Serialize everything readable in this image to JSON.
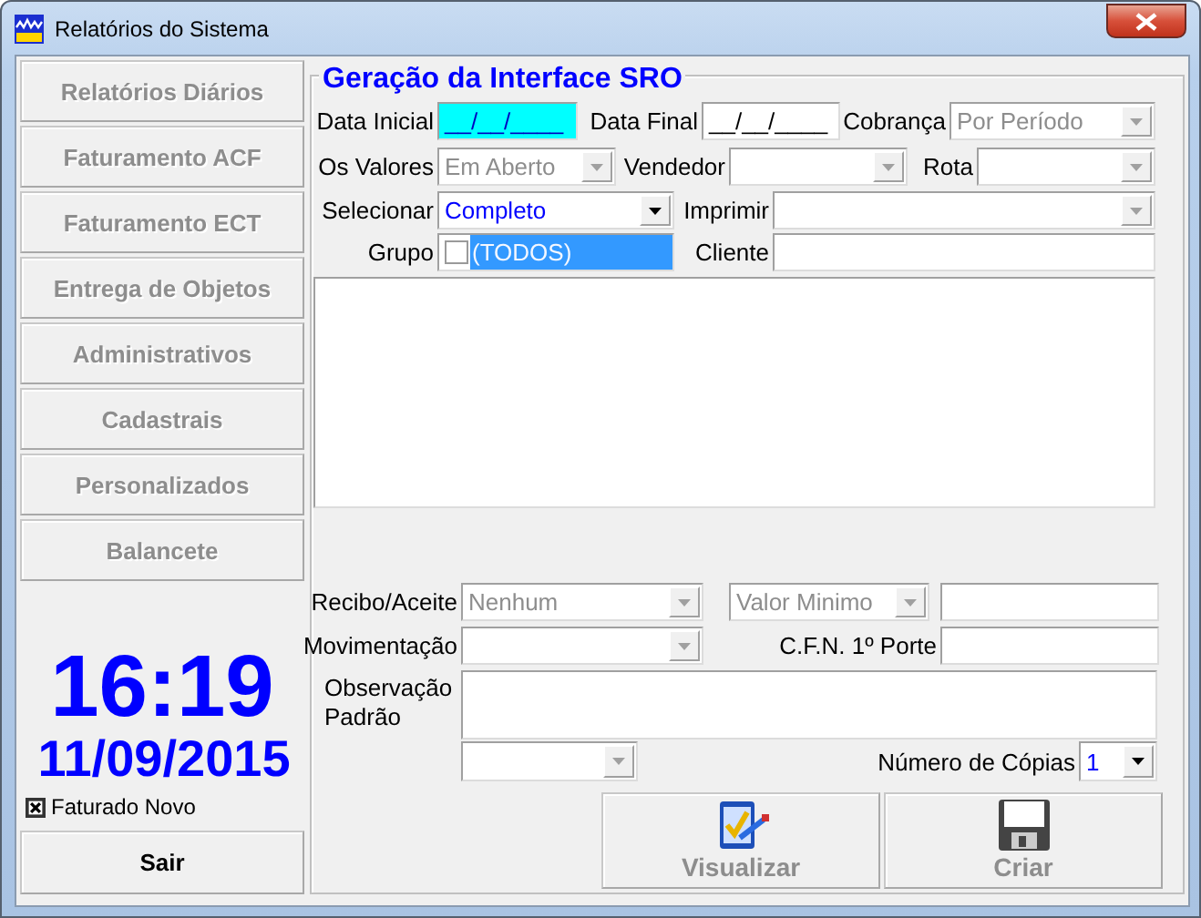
{
  "window": {
    "title": "Relatórios do Sistema"
  },
  "sidebar": {
    "items": [
      {
        "label": "Relatórios Diários",
        "disabled": true
      },
      {
        "label": "Faturamento ACF",
        "disabled": true
      },
      {
        "label": "Faturamento ECT",
        "disabled": true
      },
      {
        "label": "Entrega de Objetos",
        "disabled": true
      },
      {
        "label": "Administrativos",
        "disabled": true
      },
      {
        "label": "Cadastrais",
        "disabled": true
      },
      {
        "label": "Personalizados",
        "disabled": true
      },
      {
        "label": "Balancete",
        "disabled": true
      }
    ]
  },
  "clock": {
    "time": "16:19",
    "date": "11/09/2015"
  },
  "faturado_novo": {
    "label": "Faturado Novo",
    "checked": true
  },
  "exit_button": {
    "label": "Sair",
    "disabled": false
  },
  "form": {
    "title": "Geração da Interface SRO",
    "rows": [
      {
        "fields": [
          {
            "label": "Data Inicial",
            "kind": "date",
            "value": "__/__/____",
            "focused": true
          },
          {
            "label": "Data Final",
            "kind": "date",
            "value": "__/__/____",
            "focused": false
          },
          {
            "label": "Cobrança",
            "kind": "combo",
            "value": "Por Período",
            "disabled": true
          }
        ]
      },
      {
        "fields": [
          {
            "label": "Os Valores",
            "kind": "combo",
            "value": "Em Aberto",
            "disabled": true
          },
          {
            "label": "Vendedor",
            "kind": "combo",
            "disabled": true
          },
          {
            "label": "Rota",
            "kind": "combo",
            "disabled": true
          }
        ]
      },
      {
        "fields": [
          {
            "label": "Selecionar",
            "kind": "combo",
            "value": "Completo",
            "disabled": false
          },
          {
            "label": "Imprimir",
            "kind": "combo",
            "disabled": true
          }
        ]
      },
      {
        "fields": [
          {
            "label": "Grupo",
            "kind": "checklist",
            "value": "(TODOS)",
            "checked": false,
            "selected": true
          },
          {
            "label": "Cliente",
            "kind": "text"
          }
        ]
      },
      {
        "fields": [
          {
            "kind": "list"
          }
        ]
      },
      {
        "fields": [
          {
            "label": "Recibo/Aceite",
            "kind": "combo",
            "value": "Nenhum",
            "disabled": true
          },
          {
            "kind": "combo",
            "value": "Valor Minimo",
            "disabled": true
          },
          {
            "kind": "text"
          }
        ]
      },
      {
        "fields": [
          {
            "label": "Movimentação",
            "kind": "combo",
            "disabled": true
          },
          {
            "label": "C.F.N. 1º Porte",
            "kind": "text"
          }
        ]
      },
      {
        "fields": [
          {
            "label": "Observação Padrão",
            "kind": "memo"
          }
        ]
      },
      {
        "fields": [
          {
            "kind": "combo",
            "disabled": true
          },
          {
            "label": "Número de Cópias",
            "kind": "combo",
            "value": "1",
            "disabled": false
          }
        ]
      }
    ]
  },
  "buttons": [
    {
      "label": "Visualizar",
      "kind": "preview",
      "disabled": true
    },
    {
      "label": "Criar",
      "kind": "save",
      "disabled": true
    }
  ]
}
